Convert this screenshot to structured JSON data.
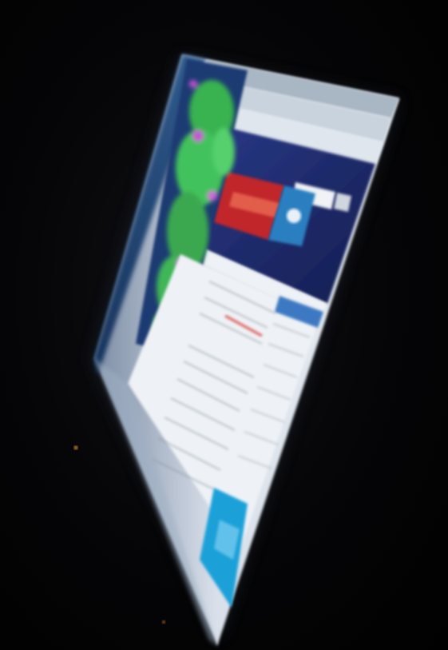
{
  "photo": {
    "subject": "laptop-screen-at-angle",
    "colors": {
      "background": "#030303",
      "screen_glow": "#dfe6ee",
      "browser_chrome": "#9aa8b6",
      "site_header": "#1f2a6b",
      "banner_red": "#c0282a",
      "banner_blue": "#2c7fc0",
      "foliage_green": "#3fbf5a",
      "foliage_magenta": "#c84fd6",
      "desktop_blue": "#2a4c7a",
      "sidebar_blue": "#3d79c2",
      "ad_cyan": "#1aa0d8"
    }
  }
}
